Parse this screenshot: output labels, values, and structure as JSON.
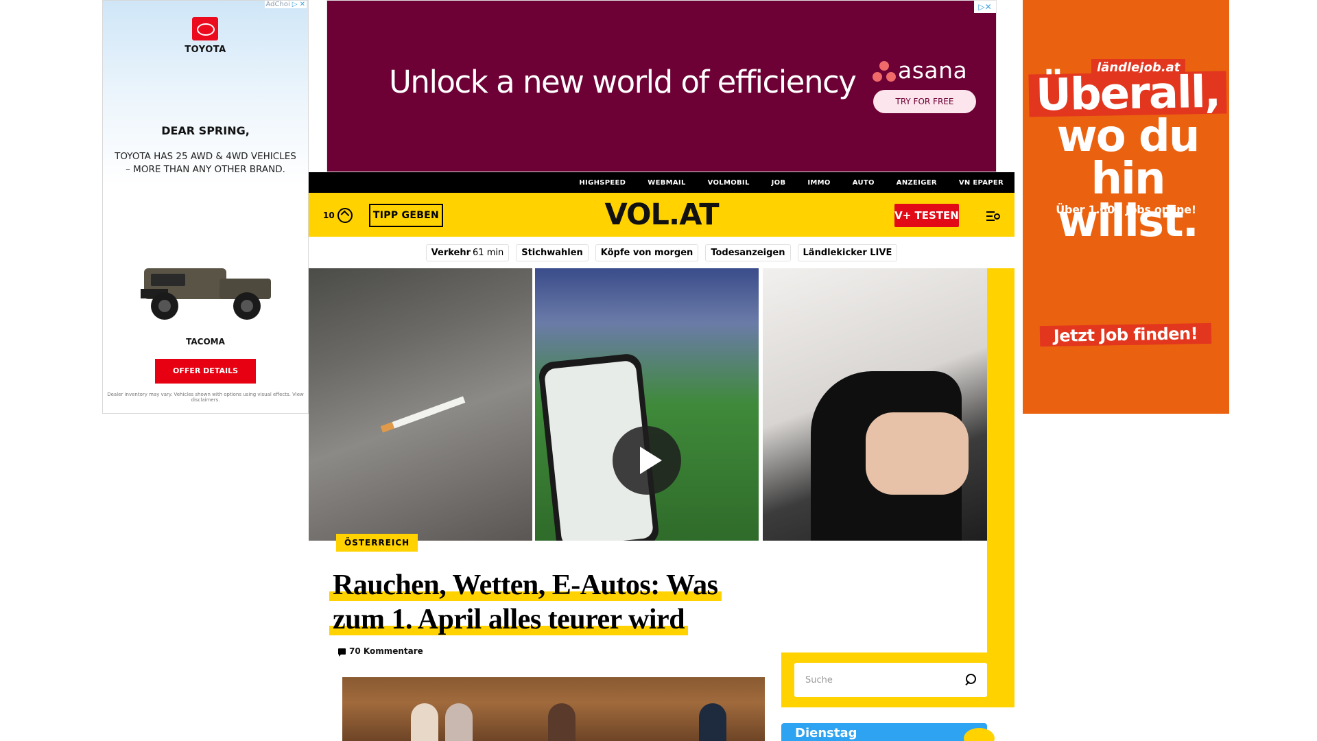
{
  "ad_left": {
    "adchoices": "AdChoi",
    "brand": "TOYOTA",
    "headline": "DEAR SPRING,",
    "copy": "TOYOTA HAS 25 AWD & 4WD VEHICLES – MORE THAN ANY OTHER BRAND.",
    "model": "TACOMA",
    "cta": "OFFER DETAILS",
    "disclaimer": "Dealer inventory may vary. Vehicles shown with options using visual effects. View disclaimers."
  },
  "ad_top": {
    "headline": "Unlock a new world of efficiency",
    "brand": "asana",
    "cta": "TRY FOR FREE",
    "brand_color": "#6d0035"
  },
  "ad_right": {
    "logo": "ländlejob.at",
    "headline_1": "Überall,",
    "headline_2": "wo du hin",
    "headline_3": "willst.",
    "sub": "Über 1.600 Jobs online!",
    "cta": "Jetzt Job finden!",
    "bg_color": "#ea620f"
  },
  "topnav": {
    "items": [
      "HIGHSPEED",
      "WEBMAIL",
      "VOLMOBIL",
      "JOB",
      "IMMO",
      "AUTO",
      "ANZEIGER",
      "VN EPAPER"
    ]
  },
  "header": {
    "temperature": "10",
    "weather_icon": "weather-icon",
    "tipp": "TIPP GEBEN",
    "logo": "VOL.AT",
    "vplus": "V+ TESTEN",
    "accent": "#ffd200"
  },
  "quicklinks": {
    "verkehr": "Verkehr",
    "verkehr_time": "61 min",
    "items": [
      "Stichwahlen",
      "Köpfe von morgen",
      "Todesanzeigen",
      "Ländlekicker LIVE"
    ]
  },
  "article": {
    "category": "ÖSTERREICH",
    "headline_line1": "Rauchen, Wetten, E-Autos: Was",
    "headline_line2": "zum 1. April alles teurer wird",
    "comments": "70 Kommentare"
  },
  "search": {
    "placeholder": "Suche"
  },
  "weather_card": {
    "day": "Dienstag"
  }
}
